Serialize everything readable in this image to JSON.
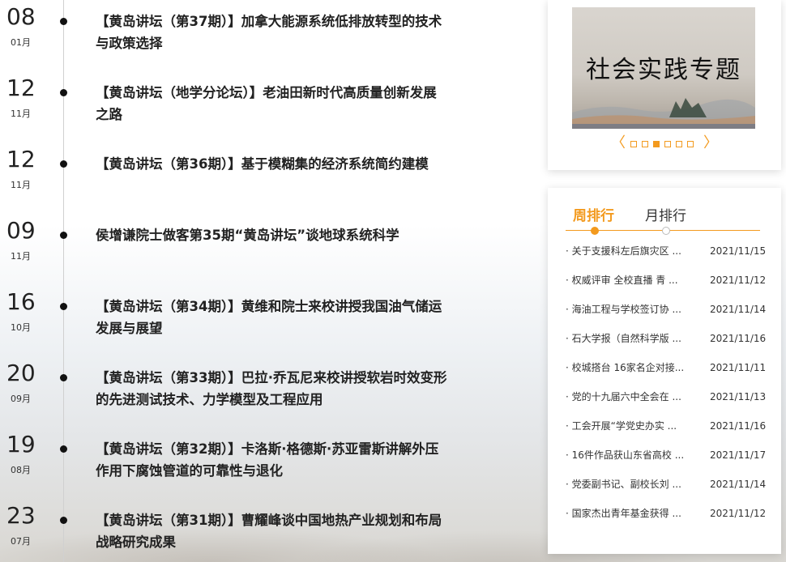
{
  "timeline": [
    {
      "day": "08",
      "month": "01月",
      "title": "【黄岛讲坛（第37期）】加拿大能源系统低排放转型的技术与政策选择"
    },
    {
      "day": "12",
      "month": "11月",
      "title": "【黄岛讲坛（地学分论坛）】老油田新时代高质量创新发展之路"
    },
    {
      "day": "12",
      "month": "11月",
      "title": "【黄岛讲坛（第36期）】基于模糊集的经济系统简约建模"
    },
    {
      "day": "09",
      "month": "11月",
      "title": "侯增谦院士做客第35期“黄岛讲坛”谈地球系统科学"
    },
    {
      "day": "16",
      "month": "10月",
      "title": "【黄岛讲坛（第34期）】黄维和院士来校讲授我国油气储运发展与展望"
    },
    {
      "day": "20",
      "month": "09月",
      "title": "【黄岛讲坛（第33期）】巴拉·乔瓦尼来校讲授软岩时效变形的先进测试技术、力学模型及工程应用"
    },
    {
      "day": "19",
      "month": "08月",
      "title": "【黄岛讲坛（第32期）】卡洛斯·格德斯·苏亚雷斯讲解外压作用下腐蚀管道的可靠性与退化"
    },
    {
      "day": "23",
      "month": "07月",
      "title": "【黄岛讲坛（第31期）】曹耀峰谈中国地热产业规划和布局战略研究成果"
    }
  ],
  "banner": {
    "text": "社会实践专题",
    "prev": "〈",
    "next": "〉",
    "slide_count": 6,
    "active_slide": 3
  },
  "ranking": {
    "tab_week": "周排行",
    "tab_month": "月排行",
    "items": [
      {
        "title": "· 关于支援科左后旗灾区 ...",
        "date": "2021/11/15"
      },
      {
        "title": "· 权威评审 全校直播 青 ...",
        "date": "2021/11/12"
      },
      {
        "title": "· 海油工程与学校签订协 ...",
        "date": "2021/11/14"
      },
      {
        "title": "· 石大学报（自然科学版 ...",
        "date": "2021/11/16"
      },
      {
        "title": "· 校城搭台 16家名企对接...",
        "date": "2021/11/11"
      },
      {
        "title": "· 党的十九届六中全会在 ...",
        "date": "2021/11/13"
      },
      {
        "title": "· 工会开展“学党史办实 ...",
        "date": "2021/11/16"
      },
      {
        "title": "· 16件作品获山东省高校 ...",
        "date": "2021/11/17"
      },
      {
        "title": "· 党委副书记、副校长刘 ...",
        "date": "2021/11/14"
      },
      {
        "title": "· 国家杰出青年基金获得 ...",
        "date": "2021/11/12"
      }
    ]
  },
  "colors": {
    "accent": "#f39a1e"
  }
}
